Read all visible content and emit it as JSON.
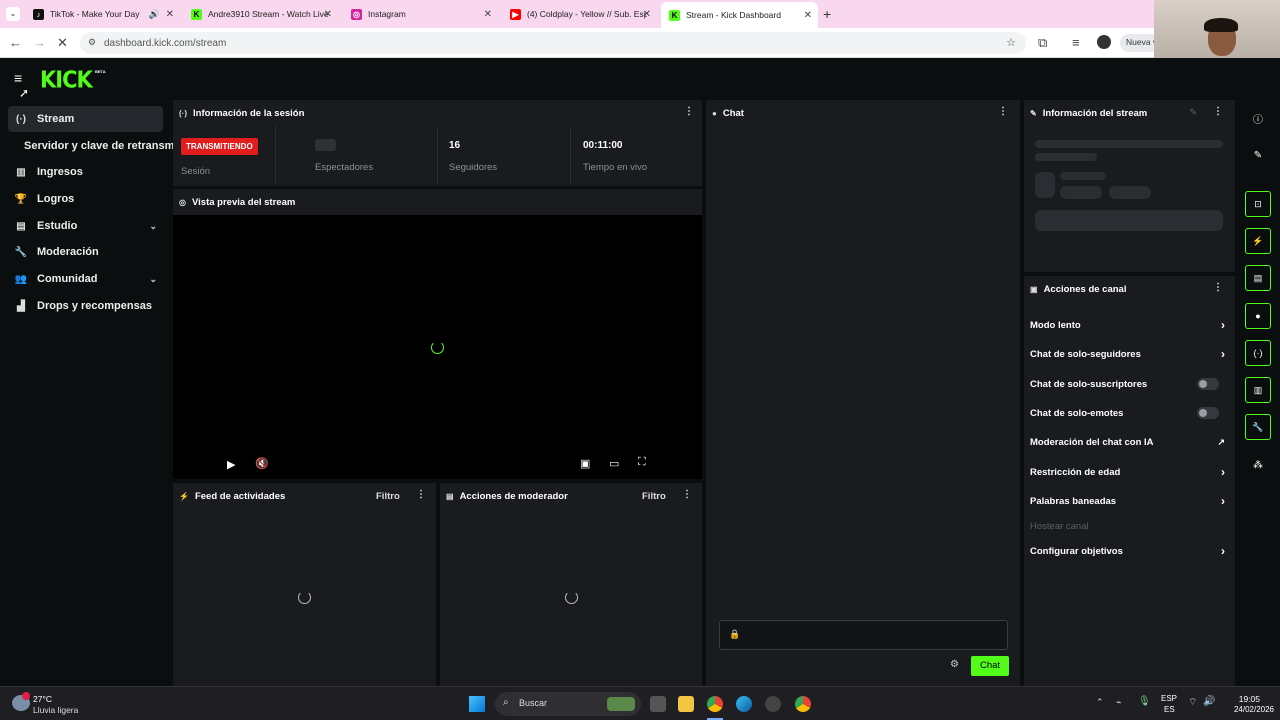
{
  "browser": {
    "tabs": [
      {
        "label": "TikTok - Make Your Day",
        "icon": "tiktok-icon",
        "color": "#111111"
      },
      {
        "label": "Andre3910 Stream - Watch Live",
        "icon": "kick-favicon",
        "color": "#53fc18"
      },
      {
        "label": "Instagram",
        "icon": "instagram-icon",
        "color": "#d6249f"
      },
      {
        "label": "(4) Coldplay - Yellow // Sub. Esp",
        "icon": "youtube-icon",
        "color": "#ff0000"
      },
      {
        "label": "Stream - Kick Dashboard",
        "icon": "kick-favicon",
        "color": "#53fc18"
      }
    ],
    "url": "dashboard.kick.com/stream",
    "profile_button": "Nueva v"
  },
  "app": {
    "logo": "KICK",
    "beta": "BETA",
    "sidebar": {
      "items": [
        {
          "label": "Stream",
          "icon": "broadcast-icon",
          "selected": true
        },
        {
          "label": "Servidor y clave de retransm",
          "icon": "",
          "sub": true
        },
        {
          "label": "Ingresos",
          "icon": "chart-icon"
        },
        {
          "label": "Logros",
          "icon": "trophy-icon"
        },
        {
          "label": "Estudio",
          "icon": "studio-icon",
          "expandable": true
        },
        {
          "label": "Moderación",
          "icon": "wrench-icon"
        },
        {
          "label": "Comunidad",
          "icon": "community-icon",
          "expandable": true
        },
        {
          "label": "Drops y recompensas",
          "icon": "drops-icon"
        }
      ]
    },
    "session": {
      "title": "Información de la sesión",
      "badge": "TRANSMITIENDO",
      "stats": [
        {
          "value": "",
          "label": "Sesión"
        },
        {
          "value": "",
          "label": "Espectadores"
        },
        {
          "value": "16",
          "label": "Seguidores"
        },
        {
          "value": "00:11:00",
          "label": "Tiempo en vivo"
        }
      ]
    },
    "preview": {
      "title": "Vista previa del stream"
    },
    "activity": {
      "title": "Feed de actividades",
      "filter": "Filtro"
    },
    "modactions": {
      "title": "Acciones de moderador",
      "filter": "Filtro"
    },
    "chat": {
      "title": "Chat",
      "send": "Chat"
    },
    "stream_info": {
      "title": "Información del stream"
    },
    "channel_actions": {
      "title": "Acciones de canal",
      "items": [
        {
          "label": "Modo lento",
          "control": "arrow"
        },
        {
          "label": "Chat de solo-seguidores",
          "control": "arrow"
        },
        {
          "label": "Chat de solo-suscriptores",
          "control": "toggle"
        },
        {
          "label": "Chat de solo-emotes",
          "control": "toggle"
        },
        {
          "label": "Moderación del chat con IA",
          "control": "external"
        },
        {
          "label": "Restricción de edad",
          "control": "arrow"
        },
        {
          "label": "Palabras baneadas",
          "control": "arrow"
        },
        {
          "label": "Hostear canal",
          "control": "none",
          "disabled": true
        },
        {
          "label": "Configurar objetivos",
          "control": "arrow"
        }
      ]
    }
  },
  "taskbar": {
    "weather_temp": "27°C",
    "weather_desc": "Lluvia ligera",
    "search": "Buscar",
    "lang_top": "ESP",
    "lang_bottom": "ES",
    "time": "19:05",
    "date": "24/02/2026"
  },
  "colors": {
    "accent": "#53fc18",
    "live": "#e11d1d",
    "panel": "#191b1f"
  }
}
